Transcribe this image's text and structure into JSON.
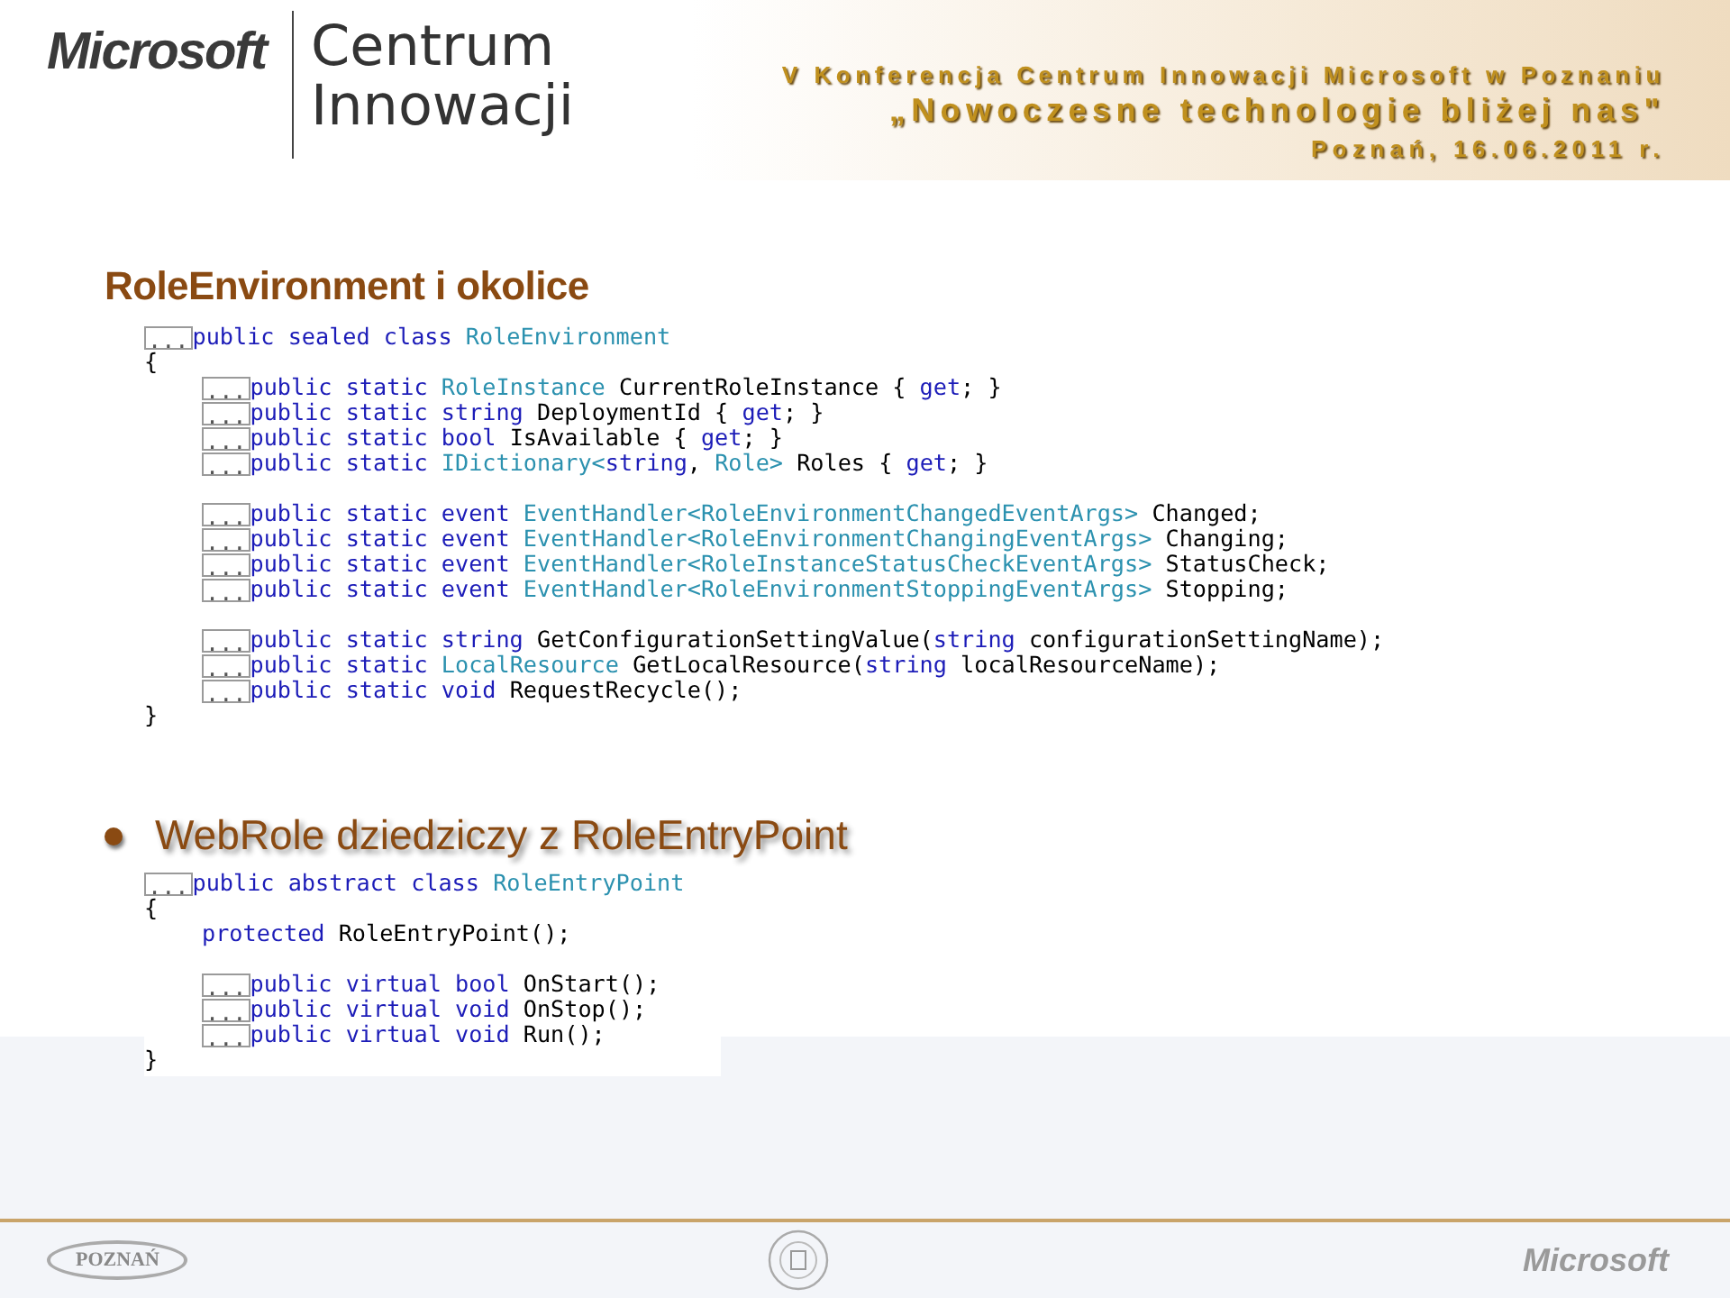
{
  "header": {
    "logo": "Microsoft",
    "brand_line_1": "Centrum",
    "brand_line_2": "Innowacji",
    "conference": "V Konferencja Centrum Innowacji Microsoft w Poznaniu",
    "motto": "„Nowoczesne technologie bliżej nas\"",
    "place_date": "Poznań, 16.06.2011 r."
  },
  "title": "RoleEnvironment i okolice",
  "code_blocks": [
    {
      "header": {
        "fold": "...",
        "tokens": [
          {
            "kind": "keyword",
            "text": "public sealed class "
          },
          {
            "kind": "type",
            "text": "RoleEnvironment"
          }
        ]
      },
      "open": "{",
      "members": [
        {
          "kind": "line",
          "fold": "...",
          "tokens": [
            {
              "kind": "keyword",
              "text": "public static "
            },
            {
              "kind": "type",
              "text": "RoleInstance"
            },
            {
              "kind": "plain",
              "text": " CurrentRoleInstance { "
            },
            {
              "kind": "keyword",
              "text": "get"
            },
            {
              "kind": "plain",
              "text": "; }"
            }
          ]
        },
        {
          "kind": "line",
          "fold": "...",
          "tokens": [
            {
              "kind": "keyword",
              "text": "public static string"
            },
            {
              "kind": "plain",
              "text": " DeploymentId { "
            },
            {
              "kind": "keyword",
              "text": "get"
            },
            {
              "kind": "plain",
              "text": "; }"
            }
          ]
        },
        {
          "kind": "line",
          "fold": "...",
          "tokens": [
            {
              "kind": "keyword",
              "text": "public static bool"
            },
            {
              "kind": "plain",
              "text": " IsAvailable { "
            },
            {
              "kind": "keyword",
              "text": "get"
            },
            {
              "kind": "plain",
              "text": "; }"
            }
          ]
        },
        {
          "kind": "line",
          "fold": "...",
          "tokens": [
            {
              "kind": "keyword",
              "text": "public static "
            },
            {
              "kind": "type",
              "text": "IDictionary<"
            },
            {
              "kind": "keyword",
              "text": "string"
            },
            {
              "kind": "plain",
              "text": ", "
            },
            {
              "kind": "type",
              "text": "Role>"
            },
            {
              "kind": "plain",
              "text": " Roles { "
            },
            {
              "kind": "keyword",
              "text": "get"
            },
            {
              "kind": "plain",
              "text": "; }"
            }
          ]
        },
        {
          "kind": "blank"
        },
        {
          "kind": "line",
          "fold": "...",
          "tokens": [
            {
              "kind": "keyword",
              "text": "public static event "
            },
            {
              "kind": "type",
              "text": "EventHandler<RoleEnvironmentChangedEventArgs>"
            },
            {
              "kind": "plain",
              "text": " Changed;"
            }
          ]
        },
        {
          "kind": "line",
          "fold": "...",
          "tokens": [
            {
              "kind": "keyword",
              "text": "public static event "
            },
            {
              "kind": "type",
              "text": "EventHandler<RoleEnvironmentChangingEventArgs>"
            },
            {
              "kind": "plain",
              "text": " Changing;"
            }
          ]
        },
        {
          "kind": "line",
          "fold": "...",
          "tokens": [
            {
              "kind": "keyword",
              "text": "public static event "
            },
            {
              "kind": "type",
              "text": "EventHandler<RoleInstanceStatusCheckEventArgs>"
            },
            {
              "kind": "plain",
              "text": " StatusCheck;"
            }
          ]
        },
        {
          "kind": "line",
          "fold": "...",
          "tokens": [
            {
              "kind": "keyword",
              "text": "public static event "
            },
            {
              "kind": "type",
              "text": "EventHandler<RoleEnvironmentStoppingEventArgs>"
            },
            {
              "kind": "plain",
              "text": " Stopping;"
            }
          ]
        },
        {
          "kind": "blank"
        },
        {
          "kind": "line",
          "fold": "...",
          "tokens": [
            {
              "kind": "keyword",
              "text": "public static string"
            },
            {
              "kind": "plain",
              "text": " GetConfigurationSettingValue("
            },
            {
              "kind": "keyword",
              "text": "string"
            },
            {
              "kind": "plain",
              "text": " configurationSettingName);"
            }
          ]
        },
        {
          "kind": "line",
          "fold": "...",
          "tokens": [
            {
              "kind": "keyword",
              "text": "public static "
            },
            {
              "kind": "type",
              "text": "LocalResource"
            },
            {
              "kind": "plain",
              "text": " GetLocalResource("
            },
            {
              "kind": "keyword",
              "text": "string"
            },
            {
              "kind": "plain",
              "text": " localResourceName);"
            }
          ]
        },
        {
          "kind": "line",
          "fold": "...",
          "tokens": [
            {
              "kind": "keyword",
              "text": "public static void"
            },
            {
              "kind": "plain",
              "text": " RequestRecycle();"
            }
          ]
        }
      ],
      "close": "}"
    }
  ],
  "bullet": "WebRole dziedziczy z RoleEntryPoint",
  "code_blocks_2": [
    {
      "header": {
        "fold": "...",
        "tokens": [
          {
            "kind": "keyword",
            "text": "public abstract class "
          },
          {
            "kind": "type",
            "text": "RoleEntryPoint"
          }
        ]
      },
      "open": "{",
      "members": [
        {
          "kind": "line",
          "tokens": [
            {
              "kind": "keyword",
              "text": "protected"
            },
            {
              "kind": "plain",
              "text": " RoleEntryPoint();"
            }
          ]
        },
        {
          "kind": "blank"
        },
        {
          "kind": "line",
          "fold": "...",
          "tokens": [
            {
              "kind": "keyword",
              "text": "public virtual bool"
            },
            {
              "kind": "plain",
              "text": " OnStart();"
            }
          ]
        },
        {
          "kind": "line",
          "fold": "...",
          "tokens": [
            {
              "kind": "keyword",
              "text": "public virtual void"
            },
            {
              "kind": "plain",
              "text": " OnStop();"
            }
          ]
        },
        {
          "kind": "line",
          "fold": "...",
          "tokens": [
            {
              "kind": "keyword",
              "text": "public virtual void"
            },
            {
              "kind": "plain",
              "text": " Run();"
            }
          ]
        }
      ],
      "close": "}"
    }
  ],
  "footer": {
    "left_logo": "POZNAŃ",
    "right_logo": "Microsoft"
  }
}
